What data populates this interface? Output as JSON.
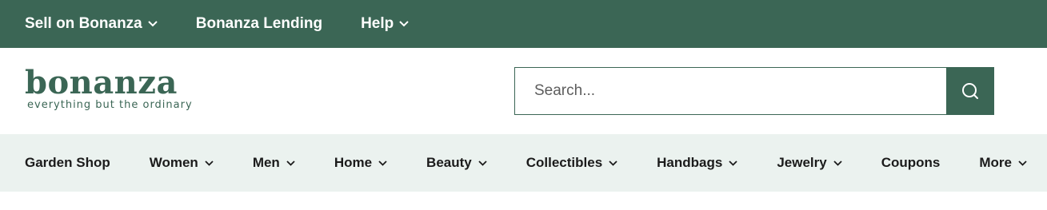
{
  "topbar": {
    "items": [
      {
        "label": "Sell on Bonanza",
        "has_dropdown": true
      },
      {
        "label": "Bonanza Lending",
        "has_dropdown": false
      },
      {
        "label": "Help",
        "has_dropdown": true
      }
    ]
  },
  "header": {
    "logo_word": "bonanza",
    "logo_tagline": "everything but the ordinary",
    "search": {
      "placeholder": "Search...",
      "button_icon": "search-icon"
    }
  },
  "categories": [
    {
      "label": "Garden Shop",
      "has_dropdown": false
    },
    {
      "label": "Women",
      "has_dropdown": true
    },
    {
      "label": "Men",
      "has_dropdown": true
    },
    {
      "label": "Home",
      "has_dropdown": true
    },
    {
      "label": "Beauty",
      "has_dropdown": true
    },
    {
      "label": "Collectibles",
      "has_dropdown": true
    },
    {
      "label": "Handbags",
      "has_dropdown": true
    },
    {
      "label": "Jewelry",
      "has_dropdown": true
    },
    {
      "label": "Coupons",
      "has_dropdown": false
    },
    {
      "label": "More",
      "has_dropdown": true
    }
  ],
  "colors": {
    "brand_green": "#3b6655",
    "nav_background": "#ebf2ef"
  }
}
